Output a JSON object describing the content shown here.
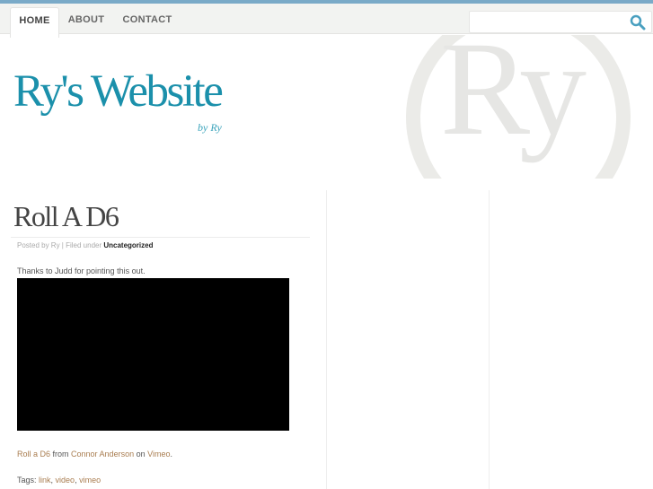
{
  "nav": {
    "tabs": [
      {
        "label": "HOME",
        "active": true
      },
      {
        "label": "ABOUT"
      },
      {
        "label": "CONTACT"
      }
    ],
    "search_placeholder": "",
    "search_icon": "search-icon"
  },
  "header": {
    "title": "Ry's Website",
    "tagline": "by Ry",
    "watermark": "Ry"
  },
  "post": {
    "title": "Roll A D6",
    "meta_prefix": "Posted by Ry | Filed under ",
    "category": "Uncategorized",
    "intro": "Thanks to Judd for pointing this out.",
    "credit": {
      "video_link": "Roll a D6",
      "from": " from ",
      "author": "Connor Anderson",
      "on": " on ",
      "site": "Vimeo",
      "end": "."
    },
    "tags_label": "Tags: ",
    "tags": [
      "link",
      "video",
      "vimeo"
    ]
  },
  "colors": {
    "accent": "#1b90ab",
    "topbar": "#7aaac8",
    "link": "#a97d50"
  }
}
